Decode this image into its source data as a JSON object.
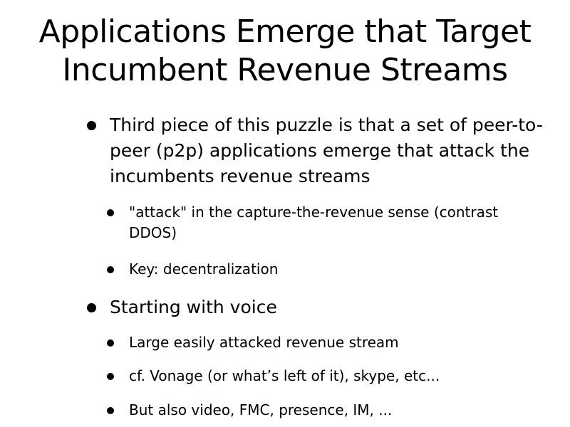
{
  "slide": {
    "title_lines": [
      "Applications Emerge that Target",
      "Incumbent Revenue Streams"
    ],
    "bullets": [
      {
        "level": 1,
        "text": "Third piece of this puzzle is that a set of peer-to-peer (p2p) applications emerge that attack the incumbents revenue streams"
      },
      {
        "level": 2,
        "text": "\"attack\" in the capture-the-revenue sense (contrast DDOS)"
      },
      {
        "level": 2,
        "text": "Key: decentralization"
      },
      {
        "level": 1,
        "text": "Starting with voice"
      },
      {
        "level": 2,
        "text": "Large easily attacked revenue stream"
      },
      {
        "level": 2,
        "text": "cf. Vonage (or what’s left of it), skype, etc..."
      },
      {
        "level": 2,
        "text": "But also video, FMC, presence, IM, ..."
      }
    ]
  }
}
